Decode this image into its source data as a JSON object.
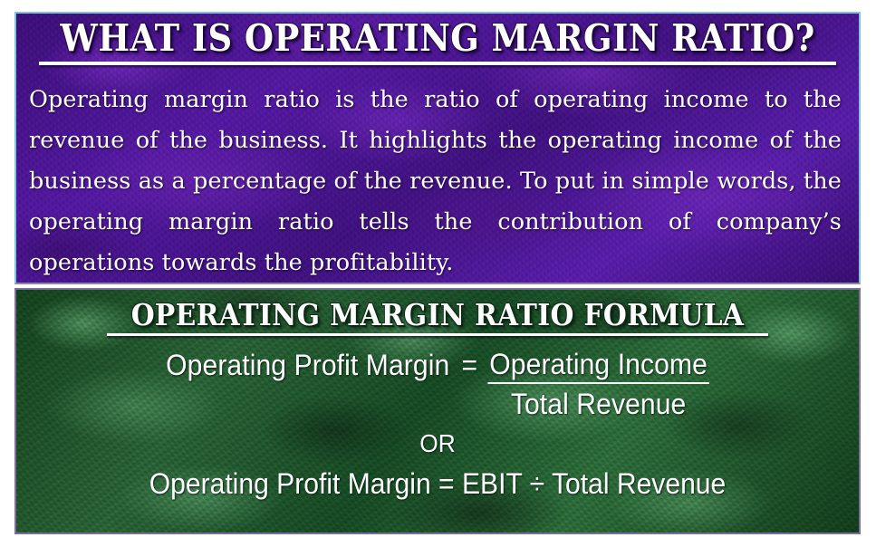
{
  "slide": {
    "purple_panel": {
      "title": "What is Operating Margin Ratio?",
      "body": "Operating margin ratio is the ratio of operating income to the revenue of the business. It highlights the operating income of the business as a percentage of the revenue. To put in simple words, the operating margin ratio tells the contribution of company’s operations towards the profitability."
    },
    "green_panel": {
      "title": "Operating Margin Ratio Formula",
      "formula_primary": {
        "left_side": "Operating Profit Margin",
        "equals": "=",
        "numerator": "Operating Income",
        "denominator": "Total Revenue"
      },
      "separator": "OR",
      "formula_alternate": "Operating Profit Margin = EBIT ÷ Total Revenue"
    }
  },
  "colors": {
    "purple_base": "#4a158c",
    "purple_dark": "#2b0b4a",
    "purple_light": "#6b2aa8",
    "purple_border": "#7ec3d9",
    "green_base": "#1f4a2c",
    "green_dark": "#143d1e",
    "green_light": "#4f8a5c",
    "green_border": "#7c6f96",
    "text": "#ffffff",
    "page_background": "#ffffff"
  }
}
